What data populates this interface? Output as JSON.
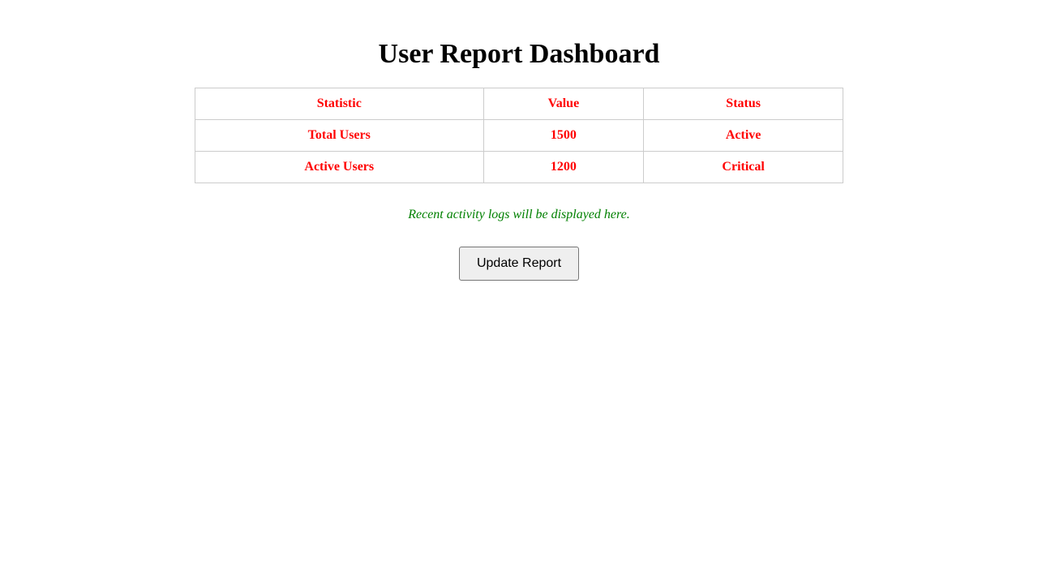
{
  "page": {
    "title": "User Report Dashboard"
  },
  "table": {
    "headers": [
      "Statistic",
      "Value",
      "Status"
    ],
    "rows": [
      [
        "Total Users",
        "1500",
        "Active"
      ],
      [
        "Active Users",
        "1200",
        "Critical"
      ]
    ]
  },
  "activity": {
    "note": "Recent activity logs will be displayed here."
  },
  "actions": {
    "update_label": "Update Report"
  },
  "colors": {
    "table_text": "#ff0000",
    "note_text": "#008000",
    "border": "#cccccc"
  }
}
